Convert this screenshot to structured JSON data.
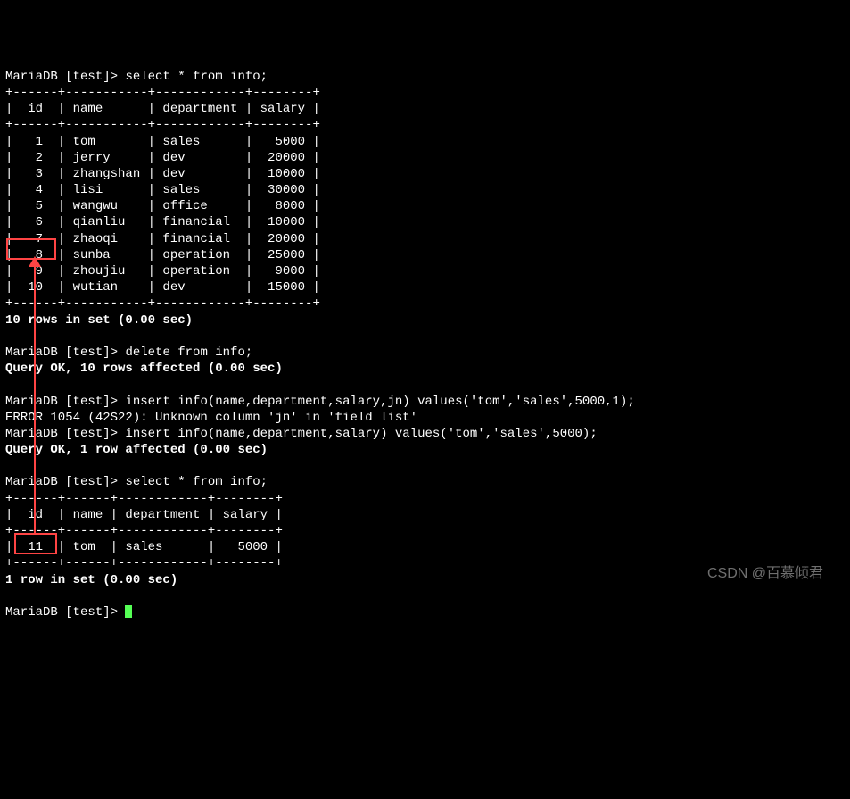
{
  "prompt": "MariaDB [test]>",
  "cmd1": "select * from info;",
  "table1": {
    "border_top": "+------+-----------+------------+--------+",
    "header": "|  id  | name      | department | salary |",
    "border_mid": "+------+-----------+------------+--------+",
    "rows": [
      "|   1  | tom       | sales      |   5000 |",
      "|   2  | jerry     | dev        |  20000 |",
      "|   3  | zhangshan | dev        |  10000 |",
      "|   4  | lisi      | sales      |  30000 |",
      "|   5  | wangwu    | office     |   8000 |",
      "|   6  | qianliu   | financial  |  10000 |",
      "|   7  | zhaoqi    | financial  |  20000 |",
      "|   8  | sunba     | operation  |  25000 |",
      "|   9  | zhoujiu   | operation  |   9000 |",
      "|  10  | wutian    | dev        |  15000 |"
    ],
    "border_bot": "+------+-----------+------------+--------+"
  },
  "result1": "10 rows in set (0.00 sec)",
  "cmd2": "delete from info;",
  "result2": "Query OK, 10 rows affected (0.00 sec)",
  "cmd3": "insert info(name,department,salary,jn) values('tom','sales',5000,1);",
  "error3": "ERROR 1054 (42S22): Unknown column 'jn' in 'field list'",
  "cmd4": "insert info(name,department,salary) values('tom','sales',5000);",
  "result4": "Query OK, 1 row affected (0.00 sec)",
  "cmd5": "select * from info;",
  "table2": {
    "border_top": "+------+------+------------+--------+",
    "header": "|  id  | name | department | salary |",
    "border_mid": "+------+------+------------+--------+",
    "rows": [
      "|  11  | tom  | sales      |   5000 |"
    ],
    "border_bot": "+------+------+------------+--------+"
  },
  "result5": "1 row in set (0.00 sec)",
  "watermark": "CSDN @百慕倾君",
  "chart_data": {
    "type": "table",
    "query1": {
      "columns": [
        "id",
        "name",
        "department",
        "salary"
      ],
      "rows": [
        [
          1,
          "tom",
          "sales",
          5000
        ],
        [
          2,
          "jerry",
          "dev",
          20000
        ],
        [
          3,
          "zhangshan",
          "dev",
          10000
        ],
        [
          4,
          "lisi",
          "sales",
          30000
        ],
        [
          5,
          "wangwu",
          "office",
          8000
        ],
        [
          6,
          "qianliu",
          "financial",
          10000
        ],
        [
          7,
          "zhaoqi",
          "financial",
          20000
        ],
        [
          8,
          "sunba",
          "operation",
          25000
        ],
        [
          9,
          "zhoujiu",
          "operation",
          9000
        ],
        [
          10,
          "wutian",
          "dev",
          15000
        ]
      ]
    },
    "query2": {
      "columns": [
        "id",
        "name",
        "department",
        "salary"
      ],
      "rows": [
        [
          11,
          "tom",
          "sales",
          5000
        ]
      ]
    }
  }
}
